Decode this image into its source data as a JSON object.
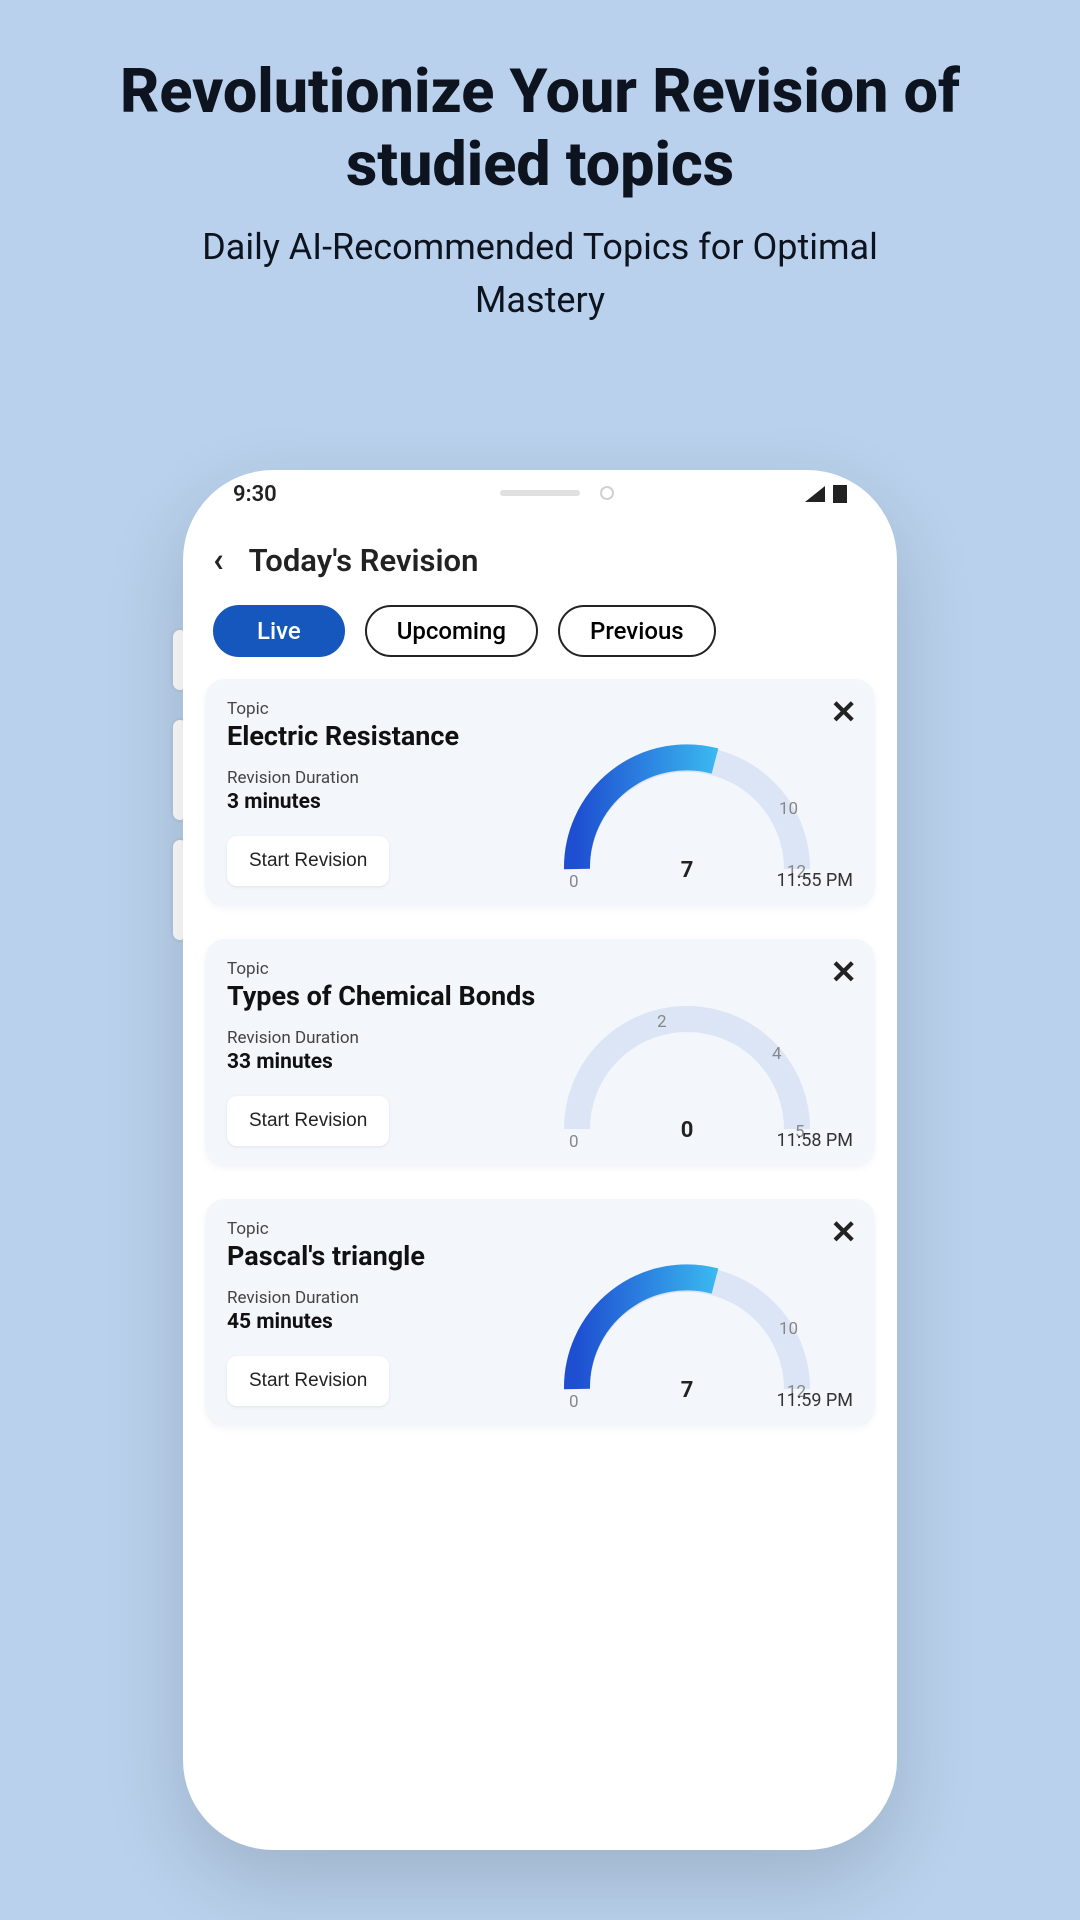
{
  "promo": {
    "title": "Revolutionize Your Revision of studied topics",
    "subtitle": "Daily AI-Recommended Topics for Optimal Mastery"
  },
  "status": {
    "time": "9:30"
  },
  "header": {
    "title": "Today's Revision"
  },
  "tabs": {
    "live": "Live",
    "upcoming": "Upcoming",
    "previous": "Previous"
  },
  "labels": {
    "topic": "Topic",
    "duration": "Revision Duration",
    "start": "Start Revision"
  },
  "cards": [
    {
      "topic": "Electric Resistance",
      "duration": "3 minutes",
      "value": "7",
      "tick_start": "0",
      "tick_mid": "10",
      "tick_end": "12",
      "time": "11:55 PM",
      "fill_fraction": 0.58
    },
    {
      "topic": "Types of Chemical Bonds",
      "duration": "33 minutes",
      "value": "0",
      "tick_start": "0",
      "tick_mid": "2",
      "tick_mid2": "4",
      "tick_end": "5",
      "time": "11:58 PM",
      "fill_fraction": 0
    },
    {
      "topic": "Pascal's triangle",
      "duration": "45 minutes",
      "value": "7",
      "tick_start": "0",
      "tick_mid": "10",
      "tick_end": "12",
      "time": "11:59 PM",
      "fill_fraction": 0.58
    }
  ],
  "chart_data": [
    {
      "type": "gauge",
      "title": "Electric Resistance",
      "value": 7,
      "min": 0,
      "max": 12,
      "ticks": [
        0,
        10,
        12
      ]
    },
    {
      "type": "gauge",
      "title": "Types of Chemical Bonds",
      "value": 0,
      "min": 0,
      "max": 5,
      "ticks": [
        0,
        2,
        4,
        5
      ]
    },
    {
      "type": "gauge",
      "title": "Pascal's triangle",
      "value": 7,
      "min": 0,
      "max": 12,
      "ticks": [
        0,
        10,
        12
      ]
    }
  ]
}
